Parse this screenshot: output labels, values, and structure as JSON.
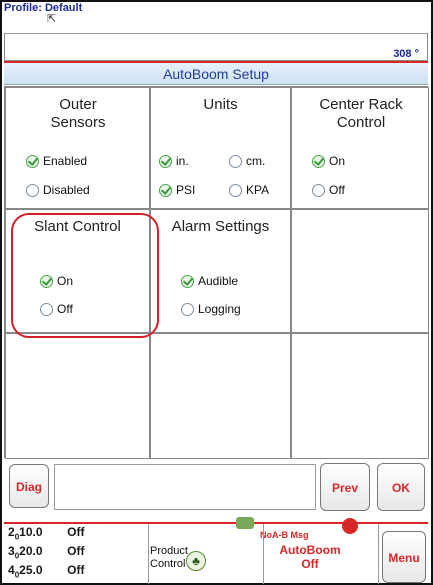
{
  "header": {
    "profile_label": "Profile:",
    "profile_value": "Default",
    "heading_value": "308 °"
  },
  "page": {
    "title": "AutoBoom Setup"
  },
  "cells": {
    "outer_sensors": {
      "title": "Outer Sensors",
      "options": [
        {
          "label": "Enabled",
          "selected": true
        },
        {
          "label": "Disabled",
          "selected": false
        }
      ]
    },
    "units": {
      "title": "Units",
      "row1": [
        {
          "label": "in.",
          "selected": true
        },
        {
          "label": "cm.",
          "selected": false
        }
      ],
      "row2": [
        {
          "label": "PSI",
          "selected": true
        },
        {
          "label": "KPA",
          "selected": false
        }
      ]
    },
    "center_rack_control": {
      "title": "Center Rack Control",
      "options": [
        {
          "label": "On",
          "selected": true
        },
        {
          "label": "Off",
          "selected": false
        }
      ]
    },
    "slant_control": {
      "title": "Slant Control",
      "options": [
        {
          "label": "On",
          "selected": true
        },
        {
          "label": "Off",
          "selected": false
        }
      ]
    },
    "alarm_settings": {
      "title": "Alarm Settings",
      "options": [
        {
          "label": "Audible",
          "selected": true
        },
        {
          "label": "Logging",
          "selected": false
        }
      ]
    }
  },
  "buttons": {
    "diag": "Diag",
    "prev": "Prev",
    "ok": "OK",
    "menu": "Menu"
  },
  "footer": {
    "rows": [
      {
        "index": "2",
        "value": "10.0",
        "state": "Off"
      },
      {
        "index": "3",
        "value": "20.0",
        "state": "Off"
      },
      {
        "index": "4",
        "value": "25.0",
        "state": "Off"
      }
    ],
    "product_control": "Product Control",
    "noab_msg": "NoA-B Msg",
    "autoboom_status_line1": "AutoBoom",
    "autoboom_status_line2": "Off"
  },
  "colors": {
    "accent_red": "#d62828",
    "title_blue": "#1f3f9a",
    "check_green": "#3a9a3a"
  }
}
